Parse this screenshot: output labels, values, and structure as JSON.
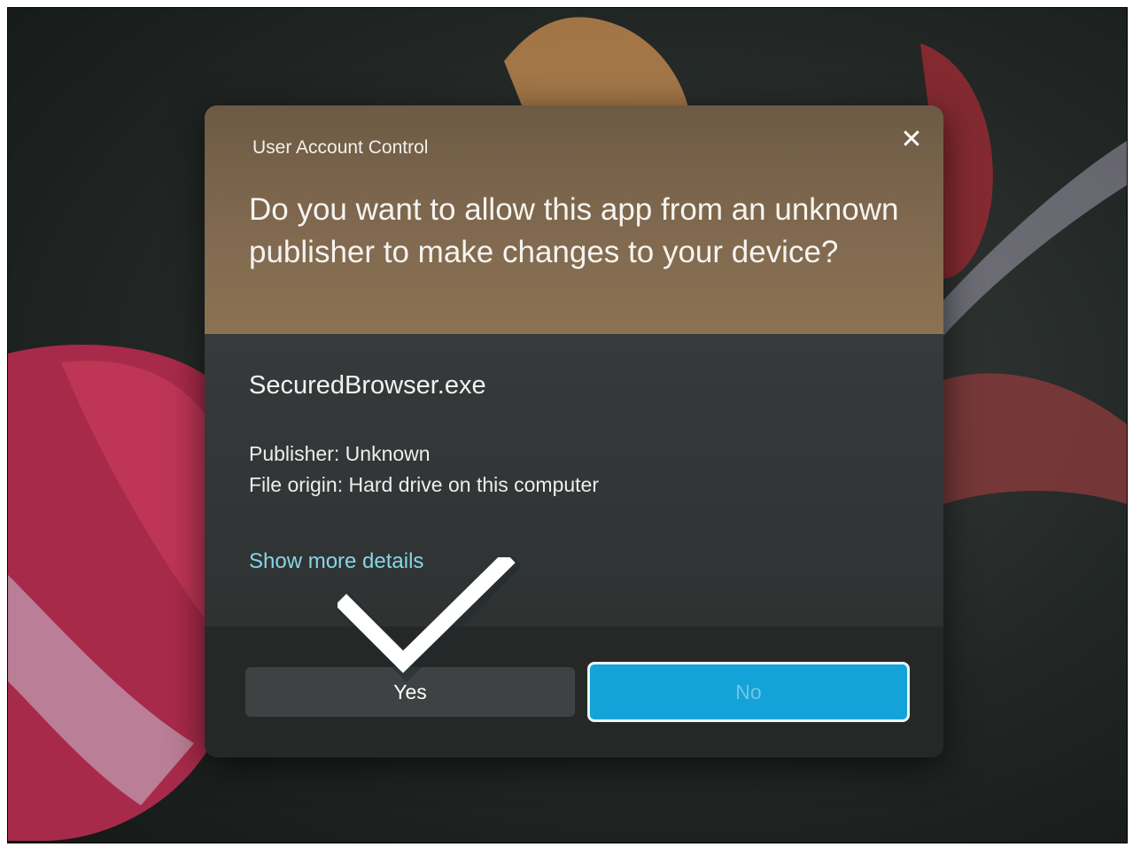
{
  "dialog": {
    "title": "User Account Control",
    "close_icon": "close-icon",
    "question": "Do you want to allow this app from an unknown publisher to make changes to your device?",
    "app_name": "SecuredBrowser.exe",
    "publisher": "Publisher: Unknown",
    "file_origin": "File origin: Hard drive on this computer",
    "details_link": "Show more details",
    "yes_label": "Yes",
    "no_label": "No"
  },
  "annotation": {
    "icon": "checkmark-icon"
  },
  "colors": {
    "header_bg": "#80694f",
    "body_bg": "#2f3232",
    "link": "#86d6e6",
    "no_button": "#14a3d8",
    "checkmark": "#ffffff"
  }
}
